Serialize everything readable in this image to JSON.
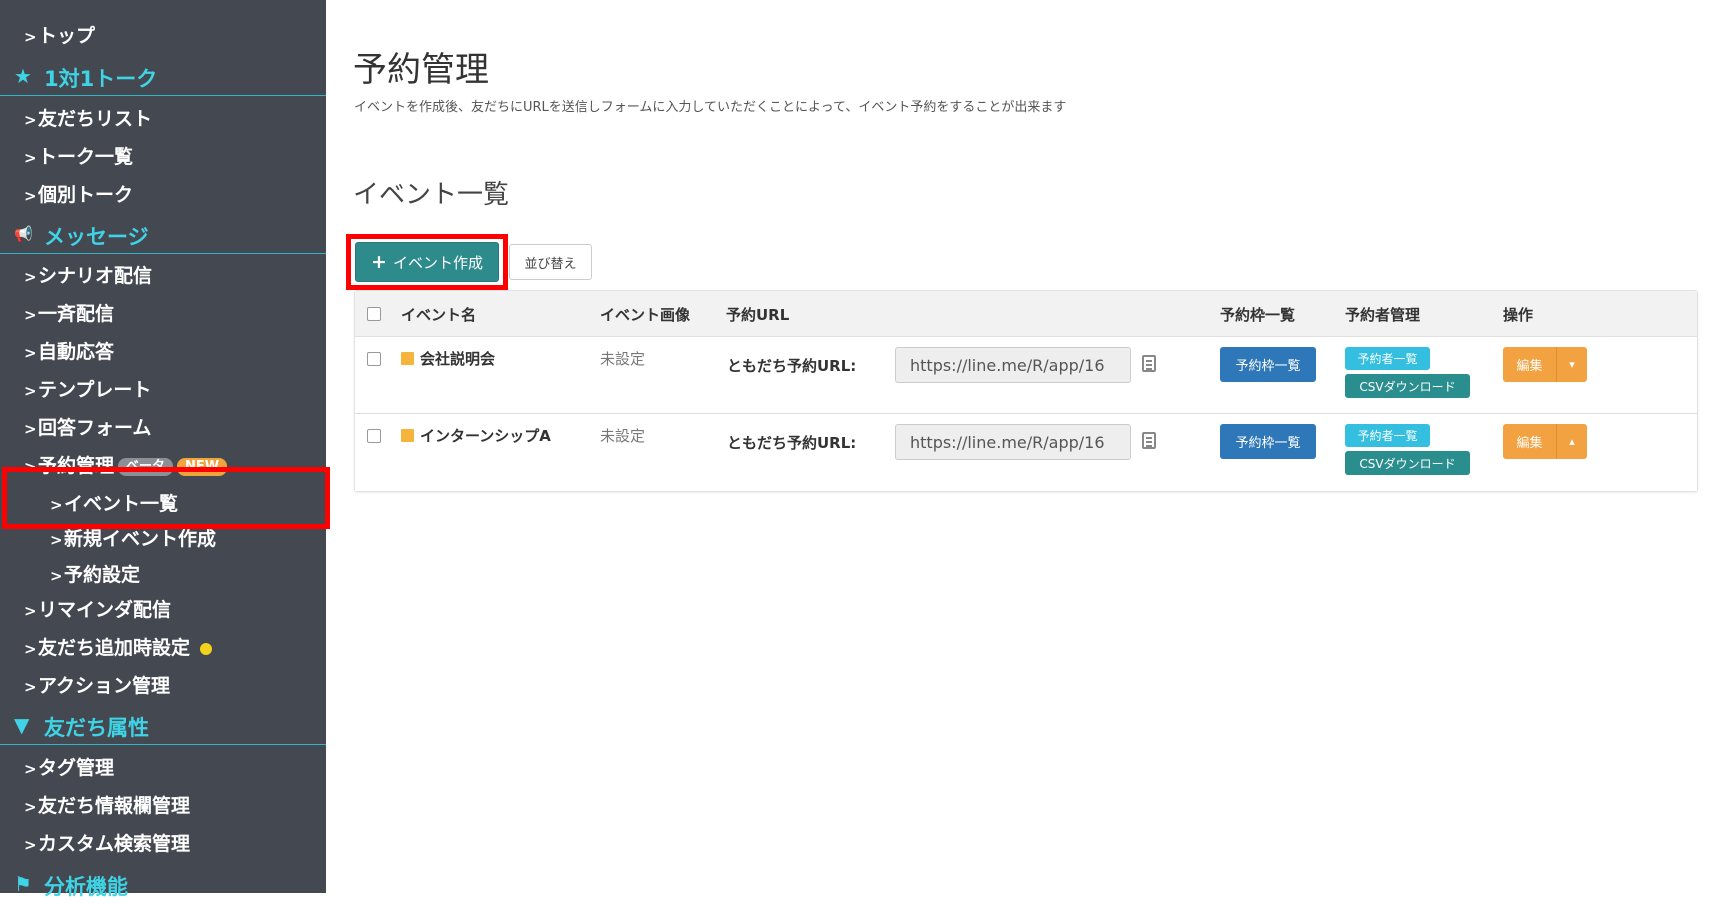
{
  "sidebar": {
    "top_item": "トップ",
    "sections": [
      {
        "icon": "star-icon",
        "glyph": "★",
        "label": "1対1トーク"
      },
      {
        "icon": "megaphone-icon",
        "glyph": "📢",
        "label": "メッセージ"
      },
      {
        "icon": "filter-icon",
        "glyph": "▼",
        "label": "友だち属性"
      },
      {
        "icon": "flag-icon",
        "glyph": "⚑",
        "label": "分析機能"
      }
    ],
    "talk_items": [
      "友だちリスト",
      "トーク一覧",
      "個別トーク"
    ],
    "message_items": [
      "シナリオ配信",
      "一斉配信",
      "自動応答",
      "テンプレート",
      "回答フォーム"
    ],
    "reservation": {
      "label": "予約管理",
      "beta_badge": "ベータ",
      "new_badge": "NEW"
    },
    "reservation_sub_items": [
      "イベント一覧",
      "新規イベント作成",
      "予約設定"
    ],
    "message_items_after": [
      "リマインダ配信",
      "友だち追加時設定",
      "アクション管理"
    ],
    "attribute_items": [
      "タグ管理",
      "友だち情報欄管理",
      "カスタム検索管理"
    ],
    "chevron": ">",
    "accent_color": "#3fd3e6",
    "bg_color": "#444851"
  },
  "main": {
    "title": "予約管理",
    "description": "イベントを作成後、友だちにURLを送信しフォームに入力していただくことによって、イベント予約をすることが出来ます",
    "section_title": "イベント一覧",
    "create_button": "イベント作成",
    "sort_button": "並び替え"
  },
  "table": {
    "headers": {
      "name": "イベント名",
      "image": "イベント画像",
      "url": "予約URL",
      "slots": "予約枠一覧",
      "reservers": "予約者管理",
      "actions": "操作"
    },
    "rows": [
      {
        "name": "会社説明会",
        "image": "未設定",
        "url_label": "ともだち予約URL:",
        "url_value": "https://line.me/R/app/16",
        "slots_button": "予約枠一覧",
        "reservers_button": "予約者一覧",
        "csv_button": "CSVダウンロード",
        "edit_button": "編集",
        "caret": "▾"
      },
      {
        "name": "インターンシップA",
        "image": "未設定",
        "url_label": "ともだち予約URL:",
        "url_value": "https://line.me/R/app/16",
        "slots_button": "予約枠一覧",
        "reservers_button": "予約者一覧",
        "csv_button": "CSVダウンロード",
        "edit_button": "編集",
        "caret": "▴"
      }
    ]
  },
  "colors": {
    "highlight": "#ff0000",
    "create_button": "#2d8b8c",
    "blue_button": "#2e77b8",
    "cyan_button": "#34bfe0",
    "orange_button": "#f2a241",
    "status_dot": "#f2d21b"
  }
}
